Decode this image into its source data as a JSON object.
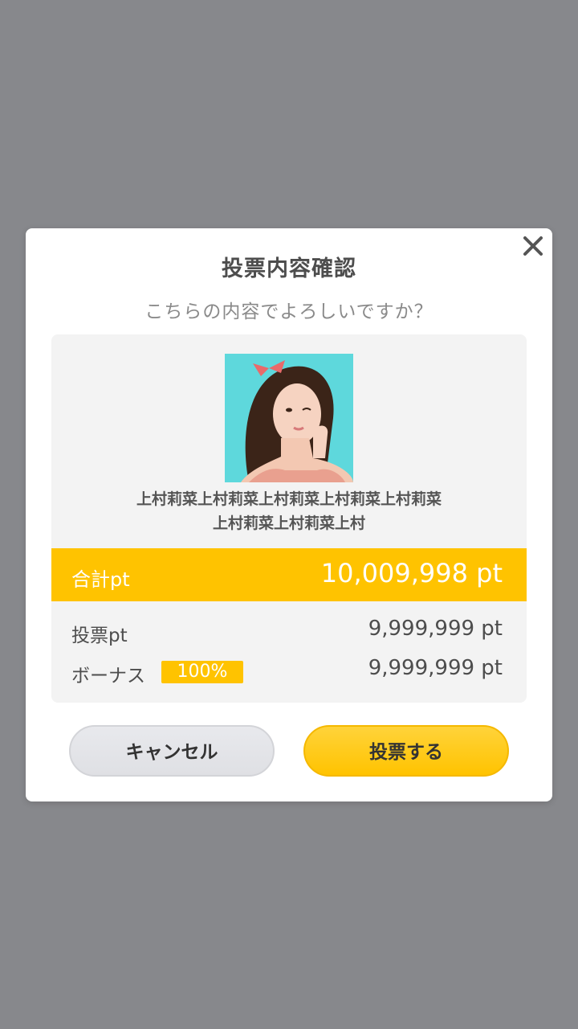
{
  "dialog": {
    "title": "投票内容確認",
    "subtitle": "こちらの内容でよろしいですか？",
    "close_icon": "close-icon"
  },
  "candidate": {
    "name_line1": "上村莉菜上村莉菜上村莉菜上村莉菜上村莉菜",
    "name_line2": "上村莉菜上村莉菜上村",
    "photo_icon": "portrait-photo"
  },
  "summary": {
    "total_label": "合計pt",
    "total_value": "10,009,998 pt",
    "vote_label": "投票pt",
    "vote_value": "9,999,999 pt",
    "bonus_label": "ボーナス",
    "bonus_badge": "100%",
    "bonus_value": "9,999,999 pt"
  },
  "buttons": {
    "cancel": "キャンセル",
    "vote": "投票する"
  },
  "colors": {
    "accent": "#ffc300",
    "overlay": "#87888c",
    "card_bg": "#f3f3f3"
  }
}
